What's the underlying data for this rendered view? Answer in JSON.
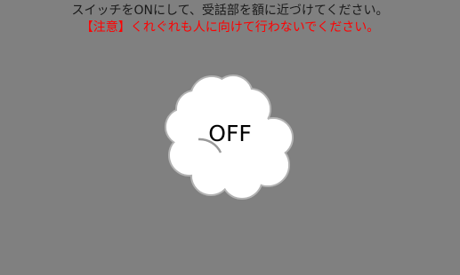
{
  "screen": {
    "background_color": "#808080"
  },
  "header": {
    "instruction": "スイッチをONにして、受話部を額に近づけてください。",
    "instruction_color": "#1a1a1a",
    "warning": "【注意】くれぐれも人に向けて行わないでください。",
    "warning_color": "#ff0000"
  },
  "switch": {
    "state_label": "OFF",
    "icon": "cloud-icon",
    "fill_color": "#ffffff",
    "outline_color": "#b3b3b3",
    "spinner_color": "#9a9a9a"
  }
}
